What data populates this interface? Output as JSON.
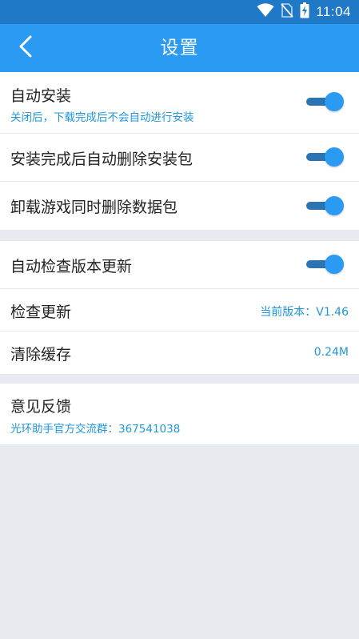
{
  "status_bar": {
    "time": "11:04",
    "icons": [
      "wifi-icon",
      "no-sim-icon",
      "battery-charging-icon"
    ]
  },
  "header": {
    "title": "设置",
    "back_icon": "chevron-left-icon"
  },
  "sections": {
    "install": {
      "auto_install": {
        "label": "自动安装",
        "sub": "关闭后，下载完成后不会自动进行安装",
        "toggle_on": true
      },
      "auto_delete_package": {
        "label": "安装完成后自动删除安装包",
        "toggle_on": true
      },
      "uninstall_delete_data": {
        "label": "卸载游戏同时删除数据包",
        "toggle_on": true
      }
    },
    "update": {
      "auto_check": {
        "label": "自动检查版本更新",
        "toggle_on": true
      },
      "check_update": {
        "label": "检查更新",
        "value": "当前版本：V1.46"
      },
      "clear_cache": {
        "label": "清除缓存",
        "value": "0.24M"
      }
    },
    "feedback": {
      "label": "意见反馈",
      "sub": "光环助手官方交流群：367541038"
    }
  },
  "colors": {
    "status_bar": "#1f79c6",
    "app_bar": "#2a9af3",
    "accent_text": "#1e97de",
    "toggle_track": "#2b74b1",
    "toggle_thumb": "#2a9af3",
    "background": "#e7ebef"
  }
}
